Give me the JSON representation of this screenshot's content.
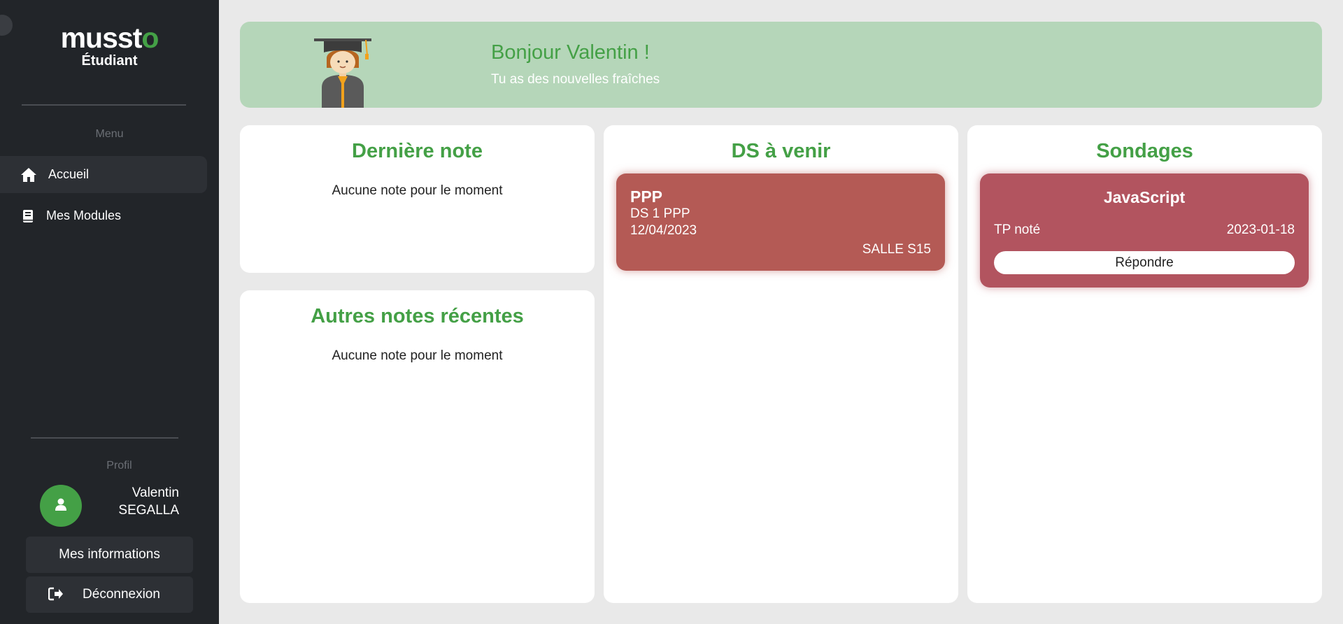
{
  "sidebar": {
    "brand_main": "muss",
    "brand_accent": "to",
    "brand_t": "t",
    "role": "Étudiant",
    "menu_label": "Menu",
    "items": [
      {
        "label": "Accueil",
        "icon": "home-icon",
        "active": true
      },
      {
        "label": "Mes Modules",
        "icon": "book-icon",
        "active": false
      }
    ],
    "profile_label": "Profil",
    "user": {
      "first_name": "Valentin",
      "last_name": "SEGALLA"
    },
    "info_button": "Mes informations",
    "logout_button": "Déconnexion"
  },
  "banner": {
    "greeting": "Bonjour Valentin !",
    "subtitle": "Tu as des nouvelles fraîches"
  },
  "last_grade": {
    "title": "Dernière note",
    "empty": "Aucune note pour le moment"
  },
  "other_grades": {
    "title": "Autres notes récentes",
    "empty": "Aucune note pour le moment"
  },
  "upcoming_ds": {
    "title": "DS à venir",
    "items": [
      {
        "subject": "PPP",
        "name": "DS 1 PPP",
        "date": "12/04/2023",
        "room": "SALLE S15"
      }
    ]
  },
  "polls": {
    "title": "Sondages",
    "items": [
      {
        "title": "JavaScript",
        "type": "TP noté",
        "date": "2023-01-18",
        "action": "Répondre"
      }
    ]
  },
  "colors": {
    "accent_green": "#44a046",
    "sidebar_bg": "#222529",
    "banner_bg": "#b5d6b9",
    "ds_card": "#b45a55",
    "poll_card": "#b2545f"
  }
}
